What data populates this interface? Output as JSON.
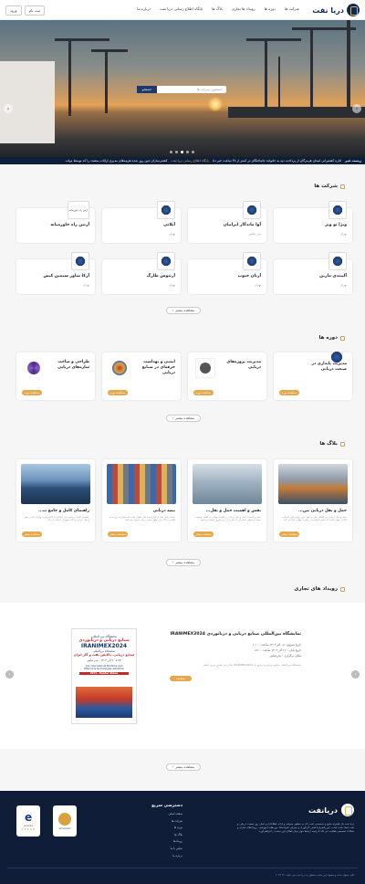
{
  "header": {
    "brand": "دریا نفت",
    "nav": [
      "شرکت ها",
      "دوره ها",
      "رویداد ها تجاری",
      "بلاگ ها",
      "پایگاه اطلاع رسانی دریا نفت",
      "درباره ما"
    ],
    "register": "ورود",
    "login": "ثبت نام"
  },
  "hero": {
    "search_placeholder": "جستجوی شرکت ها ...",
    "search_button": "جستجو"
  },
  "ticker": {
    "label": "زیست فیر",
    "text1": "اداره کشتیرانی استان هرمزگان از پرداخت دیه به خانواده جانباختگان در کمتر از ۴۸ ساعت خبر داد",
    "text2": "پایگاه اطلاع رسانی دریا نفت",
    "text3": "کشتی‌سازان چین روز شده هزینه‌های مدیری ارائات متصدد را که توسط دولت"
  },
  "companies": {
    "title": "شرکت ها",
    "items": [
      {
        "name": "ویژا تو ویژ",
        "city": "تهران"
      },
      {
        "name": "آوا ماندگار ایرانیان",
        "city": "بندر عباس"
      },
      {
        "name": "آیلانی",
        "city": "تهران"
      },
      {
        "name": "آرتین راه خاورمیانه",
        "city": ""
      },
      {
        "name": "آلیبندی مارین",
        "city": "تهران"
      },
      {
        "name": "آرتان جنوب",
        "city": "تهران"
      },
      {
        "name": "آرتنوس طارگ",
        "city": "تهران"
      },
      {
        "name": "آرکا شاور سیمین کیش",
        "city": "تهران"
      }
    ],
    "top_badge": "آرتین راه خاورمیانه",
    "more": "مشاهده بیشتر"
  },
  "courses": {
    "title": "دوره ها",
    "items": [
      {
        "name": "مدیریت پایداری در صنعت دریایی",
        "btn": "مشاهده دوره"
      },
      {
        "name": "مدیریت پروژه‌های دریایی",
        "btn": "مشاهده دوره"
      },
      {
        "name": "ایمنی و بهداشت حرفه‌ای در صنایع دریایی",
        "btn": "مشاهده دوره"
      },
      {
        "name": "طراحی و ساخت سازه‌های دریایی",
        "btn": "مشاهده دوره"
      }
    ],
    "more": "مشاهده بیشتر"
  },
  "blogs": {
    "title": "بلاگ ها",
    "items": [
      {
        "name": "حمل و نقل دریایی بین...",
        "excerpt": "حمل و نقل دریایی بین المللی یکی از مهم ترین روش های جابجایی کالا در جهان است که نقش اساسی در تجارت جهانی ایفا می کند.",
        "btn": "مشاهده بیشتر"
      },
      {
        "name": "نقش و اهمیت حمل و نقل...",
        "excerpt": "نقش و اهمیت حمل و نقل دریایی در اقتصاد جهانی بر کسی پوشیده نیست و بخش عمده ای از تجارت از این طریق انجام می شود.",
        "btn": "مشاهده بیشتر"
      },
      {
        "name": "بیمه دریایی",
        "excerpt": "بیمه دریایی یکی از انواع بیمه های اموال است که خسارات وارده به کشتی و کالا را در طول سفر دریایی جبران می کند.",
        "btn": "مشاهده بیشتر"
      },
      {
        "name": "راهنمای کامل و جامع ب...",
        "excerpt": "راهنمای کامل و جامع برای آشنایی با کانتینرها و انواع آن ها در حمل و نقل دریایی و نکات مهم در انتخاب آن ها.",
        "btn": "مشاهده بیشتر"
      }
    ],
    "more": "مشاهده بیشتر"
  },
  "events": {
    "title": "رویداد های تجاری",
    "name": "نمایشگاه بین‌المللی صنایع دریایی و دریانوردی IRANIMEX2024",
    "start": "تاریخ شروع : ۰۸ آذر ۱۴۰۳ ساعت ۱۰:۰۰",
    "end": "تاریخ پایان : ۱۱ آذر ۱۴۰۳ ساعت ۱۸:۰۰",
    "place": "مکان برگزاری : بندرعباس",
    "desc": "نمایشگاه بین‌المللی صنایع دریایی و دریانوردی IRANIMEX2024 مکان بندرعباس جزیره کیش",
    "btn": "مشاهده",
    "poster_line1": "نمایشگاه بین المللی",
    "poster_line2": "صنایع دریایی و دریانوردی",
    "poster_brand": "IRANIMEX2024",
    "poster_line3": "نمایشگاه بین‌المللی",
    "poster_line4": "صنایع دریایی، پالایش نفت و گاز ایران",
    "poster_dates": "۲۷ تا ۳۰ آذر ۱۴۰۳ - بندرعباس",
    "poster_en1": "Iran International Maritime and",
    "poster_en2": "offshore & technologies exhibition",
    "poster_en3": "2024 - Bandar Abbas",
    "more": "مشاهده بیشتر"
  },
  "footer": {
    "brand": "دریانفت",
    "about": "دریا نفت یک پلتفرم جامع و تخصصی است که به منظور معرفی و ارائه اطلاعات و اخبار روز صنعت دریایی و نفت ایجاد شده است. این پلتفرم با هدف گردآوری و معرفی شرکت‌ها، دوره‌های آموزشی، رویدادهای تجاری و مقالات تخصصی فعالیت می کند تا زمینه ارتباط موثر میان فعالان این صنعت را فراهم آورد.",
    "links_title": "دسترسی سریع",
    "links": [
      "صفحه اصلی",
      "شرکت ها",
      "دوره ها",
      "بلاگ ها",
      "رویدادها",
      "تماس با ما",
      "درباره ما"
    ],
    "badge1": "enamad",
    "badge2": "samandehi",
    "copyright": "کلیه حقوق مادی و معنوی این سایت متعلق به دریا نفت می باشد. © ۲۰۲۴"
  }
}
